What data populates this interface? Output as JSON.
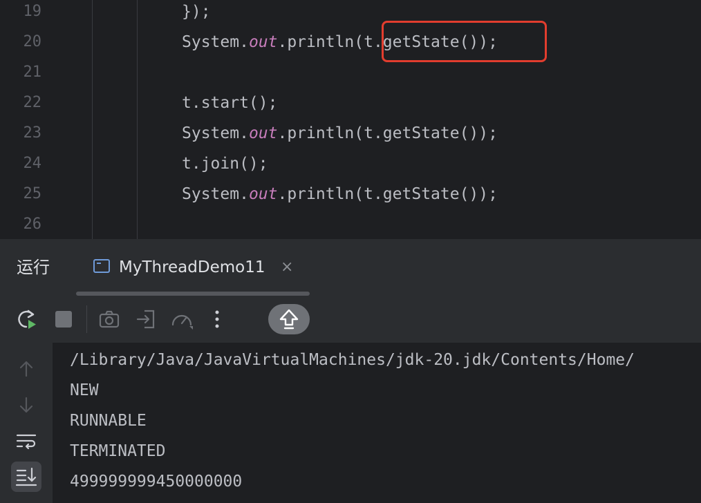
{
  "editor": {
    "line_numbers": [
      "19",
      "20",
      "21",
      "22",
      "23",
      "24",
      "25",
      "26"
    ],
    "lines": [
      {
        "a": "});",
        "kw": "",
        "b": ""
      },
      {
        "a": "System.",
        "kw": "out",
        "b": ".println(t.getState());"
      },
      {
        "a": "",
        "kw": "",
        "b": ""
      },
      {
        "a": "t.start();",
        "kw": "",
        "b": ""
      },
      {
        "a": "System.",
        "kw": "out",
        "b": ".println(t.getState());"
      },
      {
        "a": "t.join();",
        "kw": "",
        "b": ""
      },
      {
        "a": "System.",
        "kw": "out",
        "b": ".println(t.getState());"
      },
      {
        "a": "",
        "kw": "",
        "b": ""
      }
    ],
    "highlight_color": "#e23d2e"
  },
  "run_panel": {
    "title": "运行",
    "tab": {
      "label": "MyThreadDemo11",
      "close": "×",
      "icon": "console-icon"
    },
    "toolbar_icons": [
      "rerun-icon",
      "stop-icon",
      "camera-icon",
      "login-icon",
      "speedometer-icon",
      "more-vert-icon",
      "scroll-up-icon"
    ]
  },
  "console": {
    "side_icons": [
      "arrow-up-icon",
      "arrow-down-icon",
      "soft-wrap-icon",
      "scroll-to-end-icon"
    ],
    "output": [
      "/Library/Java/JavaVirtualMachines/jdk-20.jdk/Contents/Home/",
      "NEW",
      "RUNNABLE",
      "TERMINATED",
      "499999999450000000"
    ]
  }
}
